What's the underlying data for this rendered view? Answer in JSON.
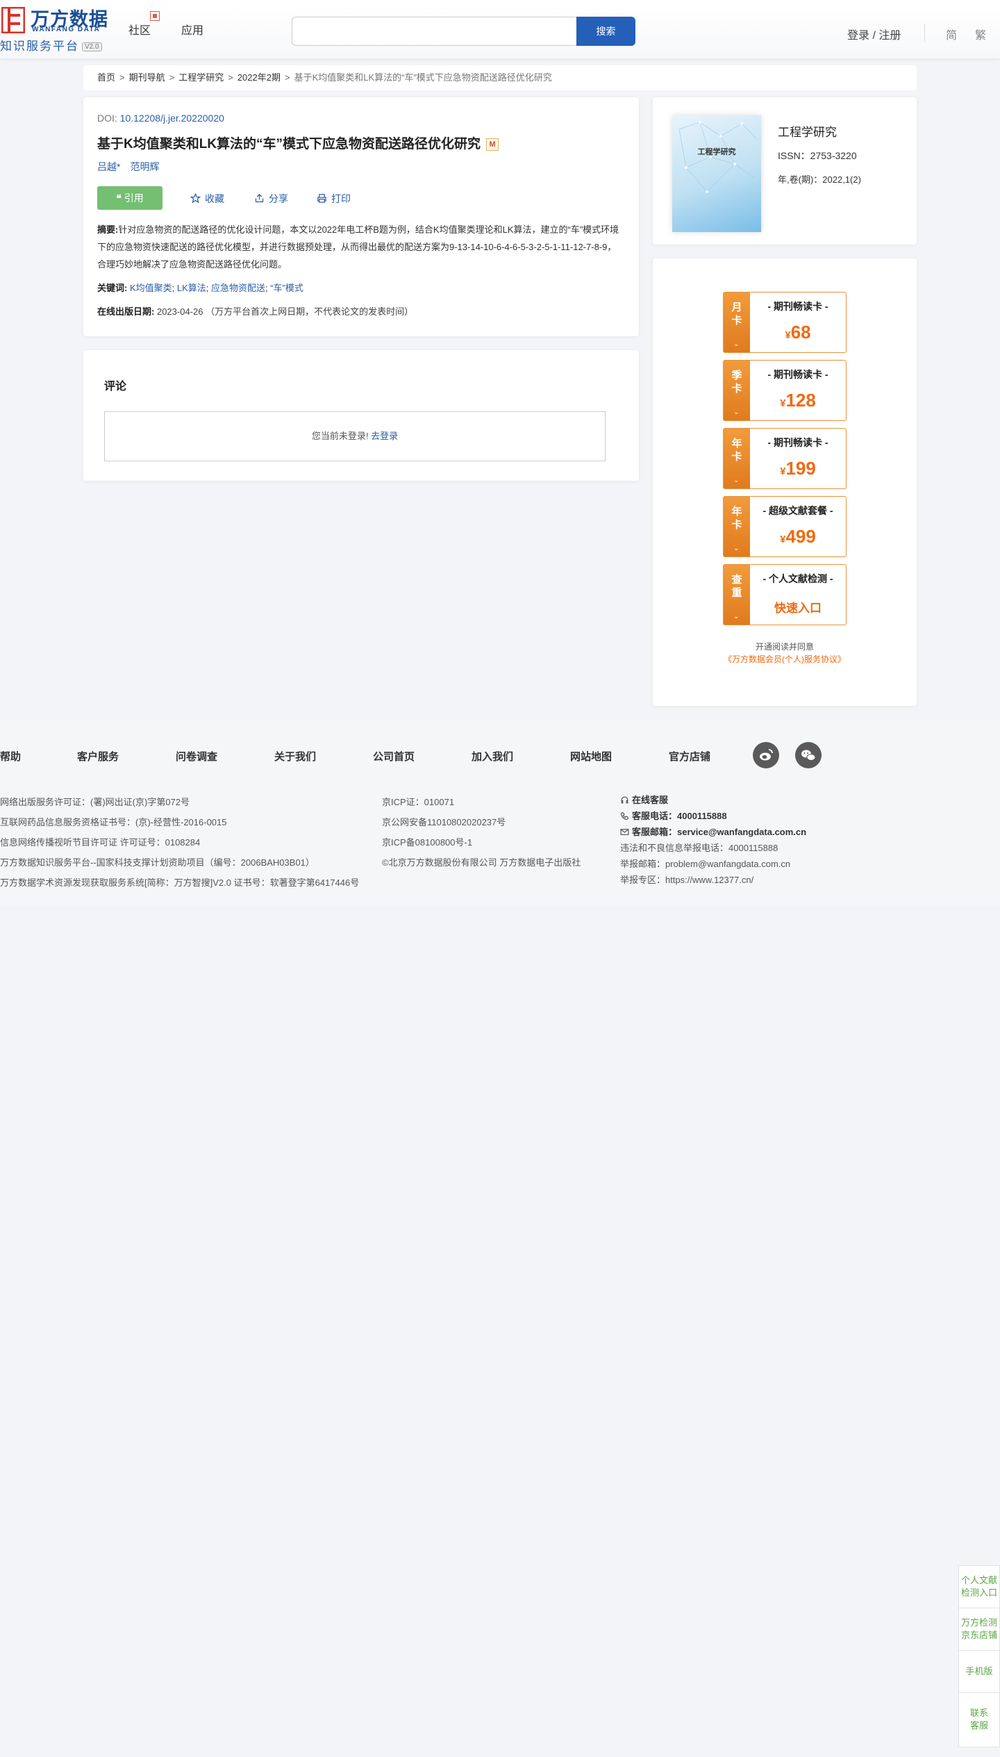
{
  "header": {
    "logo_cn": "万方数据",
    "logo_en": "WANFANG DATA",
    "logo_sub": "知识服务平台",
    "logo_version": "V2.0",
    "nav": [
      "社区",
      "应用"
    ],
    "search_placeholder": "",
    "search_button": "搜索",
    "login": "登录 / 注册",
    "lang_simplified": "简",
    "lang_traditional": "繁"
  },
  "breadcrumb": [
    "首页",
    "期刊导航",
    "工程学研究",
    "2022年2期",
    "基于K均值聚类和LK算法的“车”模式下应急物资配送路径优化研究"
  ],
  "article": {
    "doi_label": "DOI:",
    "doi": "10.12208/j.jer.20220020",
    "title": "基于K均值聚类和LK算法的“车”模式下应急物资配送路径优化研究",
    "badge": "M",
    "authors": [
      "吕越*",
      "范明辉"
    ],
    "actions": {
      "cite": "引用",
      "favorite": "收藏",
      "share": "分享",
      "print": "打印"
    },
    "abstract_label": "摘要:",
    "abstract": "针对应急物资的配送路径的优化设计问题，本文以2022年电工杯B题为例，结合K均值聚类理论和LK算法，建立的“车”模式环境下的应急物资快速配送的路径优化模型，并进行数据预处理，从而得出最优的配送方案为9-13-14-10-6-4-6-5-3-2-5-1-11-12-7-8-9，合理巧妙地解决了应急物资配送路径优化问题。",
    "keywords_label": "关键词:",
    "keywords": [
      "K均值聚类",
      "LK算法",
      "应急物资配送",
      "“车”模式"
    ],
    "keyword_sep": "; ",
    "pubdate_label": "在线出版日期:",
    "pubdate": "2023-04-26",
    "pubdate_note": "（万方平台首次上网日期，不代表论文的发表时间）"
  },
  "comments": {
    "title": "评论",
    "not_logged_in": "您当前未登录!",
    "login_link": "去登录"
  },
  "journal": {
    "cover_title": "工程学研究",
    "name": "工程学研究",
    "issn": "ISSN：2753-3220",
    "volume": "年,卷(期)：2022,1(2)"
  },
  "membership": {
    "cards": [
      {
        "side": [
          "月",
          "卡"
        ],
        "name": "- 期刊畅读卡 -",
        "currency": "¥",
        "price": "68"
      },
      {
        "side": [
          "季",
          "卡"
        ],
        "name": "- 期刊畅读卡 -",
        "currency": "¥",
        "price": "128"
      },
      {
        "side": [
          "年",
          "卡"
        ],
        "name": "- 期刊畅读卡 -",
        "currency": "¥",
        "price": "199"
      },
      {
        "side": [
          "年",
          "卡"
        ],
        "name": "- 超级文献套餐 -",
        "currency": "¥",
        "price": "499"
      },
      {
        "side": [
          "查",
          "重"
        ],
        "name": "- 个人文献检测 -",
        "currency": "",
        "price": "快速入口"
      }
    ],
    "arrow": "⌄",
    "agree_text": "开通阅读并同意",
    "agree_link": "《万方数据会员(个人)服务协议》"
  },
  "footer": {
    "nav": [
      "帮助",
      "客户服务",
      "问卷调查",
      "关于我们",
      "公司首页",
      "加入我们",
      "网站地图",
      "官方店铺"
    ],
    "col1": [
      "网络出版服务许可证：(署)网出证(京)字第072号",
      "互联网药品信息服务资格证书号：(京)-经营性-2016-0015",
      "信息网络传播视听节目许可证 许可证号：0108284",
      "万方数据知识服务平台--国家科技支撑计划资助项目（编号：2006BAH03B01）",
      "万方数据学术资源发现获取服务系统[简称：万方智搜]V2.0 证书号：软著登字第6417446号"
    ],
    "col2": [
      "京ICP证：010071",
      "京公网安备11010802020237号",
      "京ICP备08100800号-1",
      "©北京万方数据股份有限公司 万方数据电子出版社"
    ],
    "col3": {
      "online_service": "在线客服",
      "phone_label": "客服电话：",
      "phone": "4000115888",
      "email_label": "客服邮箱：",
      "email": "service@wanfangdata.com.cn",
      "report_phone": "违法和不良信息举报电话：4000115888",
      "report_email": "举报邮箱：problem@wanfangdata.com.cn",
      "report_zone": "举报专区：https://www.12377.cn/"
    }
  },
  "side_panel": [
    [
      "个人文献",
      "检测入口"
    ],
    [
      "万方检测",
      "京东店铺"
    ],
    [
      "手机版"
    ],
    [
      "联系",
      "客服"
    ]
  ],
  "colors": {
    "brand_blue": "#1c4e96",
    "link_blue": "#2a5ea8",
    "search_blue": "#2460b8",
    "cite_green": "#74bf72",
    "member_orange": "#f06a13",
    "side_green": "#5aa644"
  }
}
